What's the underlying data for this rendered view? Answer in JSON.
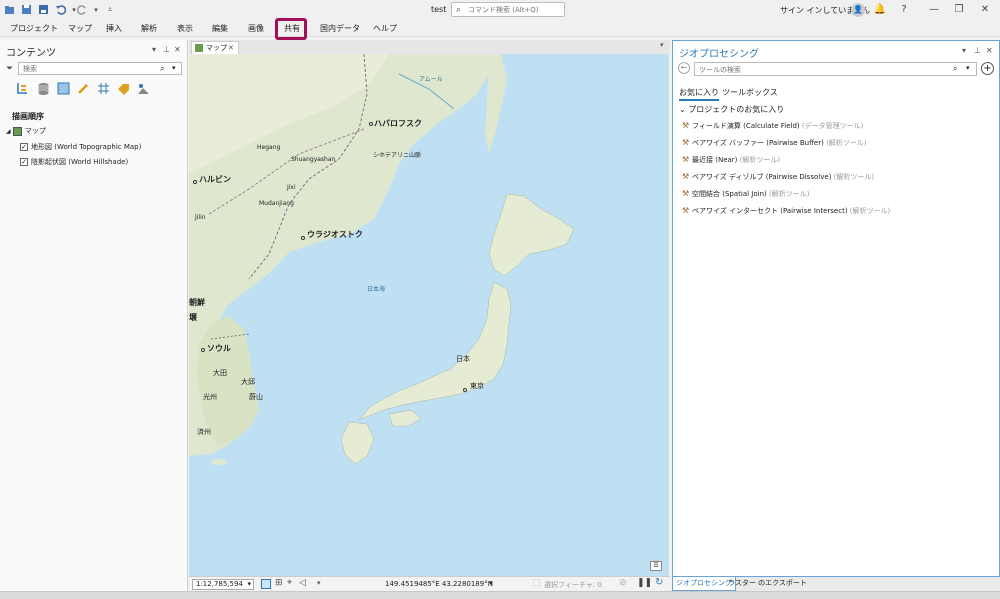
{
  "window": {
    "title": "test",
    "command_search_placeholder": "コマンド検索 (Alt+Q)",
    "signin_text": "サイン インしていません"
  },
  "ribbon": {
    "tabs": [
      "プロジェクト",
      "マップ",
      "挿入",
      "解析",
      "表示",
      "編集",
      "画像",
      "共有",
      "国内データ",
      "ヘルプ"
    ],
    "highlighted_tab": "共有",
    "highlight_color": "#a00f5a"
  },
  "contents": {
    "title": "コンテンツ",
    "search_placeholder": "検索",
    "drawing_order_label": "描画順序",
    "map_label": "マップ",
    "layers": [
      "地形図 (World Topographic Map)",
      "陰影起伏図 (World Hillshade)"
    ]
  },
  "map_view": {
    "tab_label": "マップ",
    "labels": {
      "amur": "アムール",
      "khabarovsk": "ハバロフスク",
      "sikhote": "シホテアリニ山脈",
      "hegang": "Hegang",
      "shuangyashan": "Shuangyashan",
      "harbin": "ハルビン",
      "jixi": "Jixi",
      "mudanjiang": "Mudanjiang",
      "jilin": "Jilin",
      "vladivostok": "ウラジオストク",
      "sea_of_japan": "日本海",
      "korea_n1": "朝鮮",
      "korea_n2": "壌",
      "seoul": "ソウル",
      "daejeon": "大田",
      "daegu": "大邱",
      "gwangju": "光州",
      "ulsan": "蔚山",
      "jeju": "済州",
      "japan": "日本",
      "tokyo": "東京"
    }
  },
  "status_bar": {
    "scale": "1:12,785,594",
    "coordinates": "149.4519485°E 43.2280189°N",
    "selected_features": "選択フィーチャ: 0"
  },
  "geoprocessing": {
    "title": "ジオプロセシング",
    "search_placeholder": "ツールの検索",
    "tabs": [
      "お気に入り",
      "ツールボックス"
    ],
    "favorites_header": "プロジェクトのお気に入り",
    "tools": [
      {
        "name": "フィールド演算 (Calculate Field)",
        "category": "(データ管理ツール)"
      },
      {
        "name": "ペアワイズ バッファー (Pairwise Buffer)",
        "category": "(解析ツール)"
      },
      {
        "name": "最近接 (Near)",
        "category": "(解析ツール)"
      },
      {
        "name": "ペアワイズ ディゾルブ (Pairwise Dissolve)",
        "category": "(解析ツール)"
      },
      {
        "name": "空間結合 (Spatial Join)",
        "category": "(解析ツール)"
      },
      {
        "name": "ペアワイズ インターセクト (Pairwise Intersect)",
        "category": "(解析ツール)"
      }
    ],
    "bottom_tabs": [
      "ジオプロセシング",
      "ラスター のエクスポート"
    ]
  }
}
